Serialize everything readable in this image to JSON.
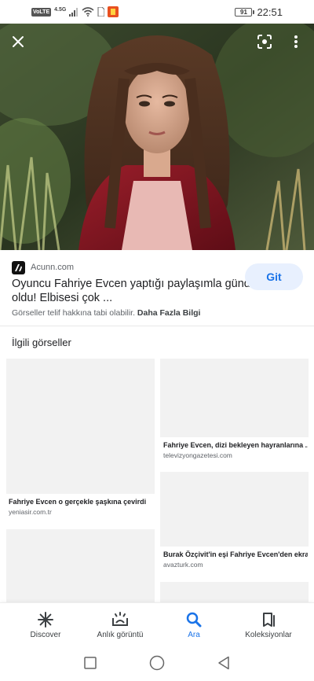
{
  "status_bar": {
    "volte": "VoLTE",
    "network": "4.5G",
    "battery": "91",
    "time": "22:51"
  },
  "result": {
    "source_name": "Acunn.com",
    "title_line1": "Oyuncu Fahriye Evcen yaptığı paylaşımla gündem",
    "title_line2": "oldu! Elbisesi çok ...",
    "visit_label": "Git",
    "copyright_text": "Görseller telif hakkına tabi olabilir.",
    "more_info_label": "Daha Fazla Bilgi"
  },
  "related": {
    "heading": "İlgili görseller",
    "items": [
      {
        "title": "Fahriye Evcen o gerçekle şaşkına çevirdi",
        "source": "yeniasir.com.tr"
      },
      {
        "title": "Fahriye Evcen, dizi bekleyen hayranlarına ...",
        "source": "televizyongazetesi.com"
      },
      {
        "title": "Burak Özçivit'in eşi Fahriye Evcen'den ekra...",
        "source": "avazturk.com"
      }
    ]
  },
  "bottom_nav": {
    "items": [
      {
        "label": "Discover",
        "icon": "asterisk-icon"
      },
      {
        "label": "Anlık görüntü",
        "icon": "snapshot-icon"
      },
      {
        "label": "Ara",
        "icon": "search-icon"
      },
      {
        "label": "Koleksiyonlar",
        "icon": "collections-icon"
      }
    ],
    "active_index": 2
  },
  "colors": {
    "accent": "#1a73e8",
    "visit_button_bg": "#e8f0fe",
    "placeholder": "#f2f2f2"
  }
}
